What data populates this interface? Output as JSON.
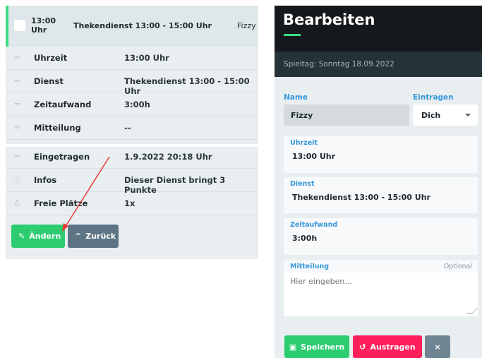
{
  "left": {
    "header": {
      "time": "13:00 Uhr",
      "title": "Thekendienst 13:00 - 15:00 Uhr",
      "user": "Fizzy"
    },
    "rows": [
      {
        "icon": "drag-handle-icon",
        "label": "Uhrzeit",
        "value": "13:00 Uhr"
      },
      {
        "icon": "drag-handle-icon",
        "label": "Dienst",
        "value": "Thekendienst 13:00 - 15:00 Uhr"
      },
      {
        "icon": "drag-handle-icon",
        "label": "Zeitaufwand",
        "value": "3:00h"
      },
      {
        "icon": "drag-handle-icon",
        "label": "Mitteilung",
        "value": "--"
      },
      {
        "icon": "drag-handle-icon",
        "label": "Eingetragen",
        "value": "1.9.2022 20:18 Uhr"
      },
      {
        "icon": "info-icon",
        "label": "Infos",
        "value": "Dieser Dienst bringt 3 Punkte"
      },
      {
        "icon": "person-icon",
        "label": "Freie Plätze",
        "value": "1x"
      }
    ],
    "buttons": {
      "edit": "Ändern",
      "back": "Zurück"
    }
  },
  "right": {
    "title": "Bearbeiten",
    "subtitle": "Spieltag: Sonntag 18.09.2022",
    "name_label": "Name",
    "name_value": "Fizzy",
    "eintragen_label": "Eintragen",
    "eintragen_value": "Dich",
    "fields": [
      {
        "label": "Uhrzeit",
        "value": "13:00 Uhr"
      },
      {
        "label": "Dienst",
        "value": "Thekendienst 13:00 - 15:00 Uhr"
      },
      {
        "label": "Zeitaufwand",
        "value": "3:00h"
      }
    ],
    "mitteilung": {
      "label": "Mitteilung",
      "optional": "Optional",
      "placeholder": "Hier eingeben..."
    },
    "buttons": {
      "save": "Speichern",
      "remove": "Austragen",
      "close": "×"
    }
  },
  "colors": {
    "green": "#2ecc71",
    "red": "#ff1f5a",
    "gray": "#5d7484",
    "blue": "#3498db",
    "dark": "#16191c"
  }
}
